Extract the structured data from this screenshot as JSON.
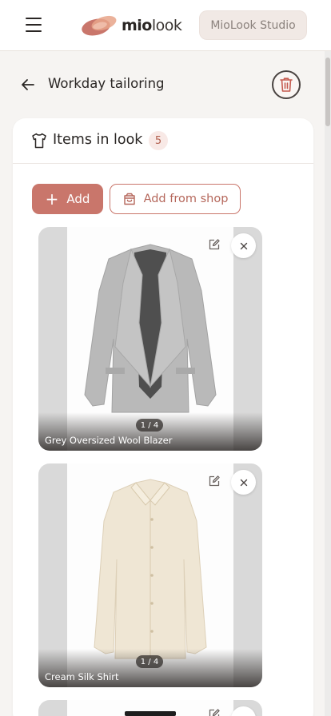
{
  "topbar": {
    "logo_bold": "mio",
    "logo_light": "look",
    "studio_label": "MioLook Studio",
    "menu_icon": "hamburger-icon"
  },
  "header": {
    "title": "Workday tailoring",
    "back_icon": "arrow-left-icon",
    "delete_icon": "trash-icon"
  },
  "panel": {
    "title": "Items in look",
    "count": "5",
    "add_label": "Add",
    "shop_label": "Add from shop"
  },
  "items": [
    {
      "name": "Grey Oversized Wool Blazer",
      "counter": "1 / 4",
      "color": "#b8b8b8"
    },
    {
      "name": "Cream Silk Shirt",
      "counter": "1 / 4",
      "color": "#efe6d4"
    }
  ],
  "colors": {
    "accent": "#c9766b",
    "accent_light": "#f8e9e6",
    "page_bg": "#f6f4f2"
  }
}
